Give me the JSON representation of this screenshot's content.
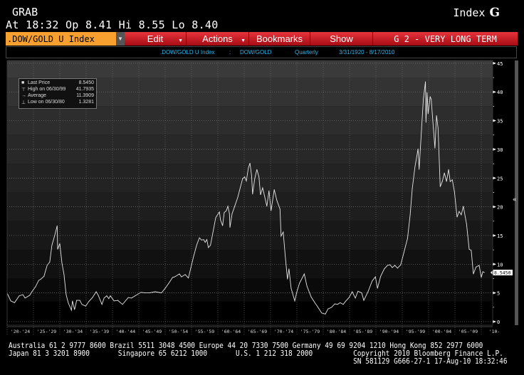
{
  "header": {
    "function": "GRAB",
    "security_type": "Index",
    "security_type_key": "G",
    "quote": "At 18:32   Op 8.41 Hi 8.55 Lo 8.40"
  },
  "toolbar": {
    "ticker": ".DOW/GOLD U Index",
    "edit": "Edit",
    "actions": "Actions",
    "bookmarks": "Bookmarks",
    "show": "Show",
    "title": "G 2 - VERY LONG TERM"
  },
  "subheader": {
    "ticker": ".DOW/GOLD U Index",
    "separator": ":",
    "name": "DOW/GOLD",
    "periodicity": "Quarterly",
    "range": "3/31/1920  -  8/17/2010"
  },
  "legend": {
    "rows": [
      {
        "label": "Last Price",
        "value": "8.5450",
        "icon": "square-icon"
      },
      {
        "label": "High on 06/30/99",
        "value": "41.7935",
        "icon": "high-marker-icon"
      },
      {
        "label": "Average",
        "value": "11.3909",
        "icon": "average-arrow-icon"
      },
      {
        "label": "Low on 06/30/80",
        "value": "1.3281",
        "icon": "low-marker-icon"
      }
    ]
  },
  "chart_data": {
    "type": "line",
    "ylim": [
      0,
      45
    ],
    "xlim": [
      1920,
      2012.3
    ],
    "yticks": [
      "0",
      "5",
      "10",
      "15",
      "20",
      "25",
      "30",
      "35",
      "40",
      "45"
    ],
    "xticks": [
      "'20-'24",
      "'25-'29",
      "'30-'34",
      "'35-'39",
      "'40-'44",
      "'45-'49",
      "'50-'54",
      "'55-'59",
      "'60-'64",
      "'65-'69",
      "'70-'74",
      "'75-'79",
      "'80-'84",
      "'85-'89",
      "'90-'94",
      "'95-'99",
      "'00-'04",
      "'05-'09",
      "'10-"
    ],
    "grid": true,
    "last_price_label": "8.5450",
    "colors": {
      "line": "#e6e6e6",
      "last_price_tag": "#ffffff"
    },
    "series": [
      {
        "points": [
          [
            1920.0,
            4.96
          ],
          [
            1920.7,
            3.6
          ],
          [
            1921.4,
            3.3
          ],
          [
            1922.3,
            4.5
          ],
          [
            1923.0,
            4.7
          ],
          [
            1923.4,
            4.1
          ],
          [
            1924.3,
            4.6
          ],
          [
            1924.7,
            5.2
          ],
          [
            1925.4,
            6.1
          ],
          [
            1926.0,
            7.2
          ],
          [
            1926.4,
            7.4
          ],
          [
            1927.0,
            7.9
          ],
          [
            1927.6,
            9.8
          ],
          [
            1928.1,
            10.4
          ],
          [
            1928.5,
            13.3
          ],
          [
            1929.0,
            14.9
          ],
          [
            1929.5,
            16.7
          ],
          [
            1929.6,
            12.6
          ],
          [
            1930.0,
            13.6
          ],
          [
            1930.4,
            10.2
          ],
          [
            1930.8,
            8.2
          ],
          [
            1931.2,
            4.7
          ],
          [
            1931.6,
            3.3
          ],
          [
            1932.2,
            2.0
          ],
          [
            1932.4,
            3.6
          ],
          [
            1932.8,
            2.1
          ],
          [
            1933.2,
            3.7
          ],
          [
            1933.8,
            3.7
          ],
          [
            1934.2,
            3.0
          ],
          [
            1934.9,
            2.7
          ],
          [
            1935.5,
            3.5
          ],
          [
            1936.2,
            4.2
          ],
          [
            1936.9,
            5.2
          ],
          [
            1937.3,
            4.6
          ],
          [
            1938.0,
            3.0
          ],
          [
            1938.4,
            4.1
          ],
          [
            1938.9,
            4.5
          ],
          [
            1939.3,
            4.0
          ],
          [
            1939.6,
            4.5
          ],
          [
            1940.3,
            3.6
          ],
          [
            1941.0,
            3.7
          ],
          [
            1941.9,
            3.0
          ],
          [
            1943.0,
            4.2
          ],
          [
            1943.6,
            4.1
          ],
          [
            1944.3,
            4.5
          ],
          [
            1945.4,
            5.1
          ],
          [
            1946.2,
            5.0
          ],
          [
            1947.0,
            5.0
          ],
          [
            1948.1,
            5.2
          ],
          [
            1949.3,
            5.0
          ],
          [
            1950.0,
            5.8
          ],
          [
            1950.7,
            6.7
          ],
          [
            1951.4,
            7.7
          ],
          [
            1951.8,
            7.8
          ],
          [
            1952.7,
            8.3
          ],
          [
            1953.1,
            7.8
          ],
          [
            1953.8,
            8.2
          ],
          [
            1954.4,
            7.6
          ],
          [
            1954.9,
            9.5
          ],
          [
            1955.4,
            11.4
          ],
          [
            1956.0,
            13.4
          ],
          [
            1956.5,
            14.6
          ],
          [
            1956.9,
            14.2
          ],
          [
            1957.3,
            14.3
          ],
          [
            1957.6,
            13.8
          ],
          [
            1957.9,
            14.3
          ],
          [
            1958.2,
            12.9
          ],
          [
            1958.6,
            13.3
          ],
          [
            1959.2,
            16.2
          ],
          [
            1959.6,
            18.1
          ],
          [
            1960.0,
            18.7
          ],
          [
            1960.3,
            19.1
          ],
          [
            1960.5,
            17.7
          ],
          [
            1960.9,
            16.7
          ],
          [
            1961.2,
            19.0
          ],
          [
            1961.6,
            19.3
          ],
          [
            1961.9,
            20.1
          ],
          [
            1962.2,
            18.8
          ],
          [
            1962.3,
            16.4
          ],
          [
            1962.7,
            18.8
          ],
          [
            1963.2,
            20.1
          ],
          [
            1963.8,
            21.7
          ],
          [
            1964.3,
            23.5
          ],
          [
            1964.7,
            24.9
          ],
          [
            1965.1,
            25.2
          ],
          [
            1965.4,
            24.5
          ],
          [
            1965.8,
            26.8
          ],
          [
            1966.1,
            27.6
          ],
          [
            1966.4,
            25.4
          ],
          [
            1966.6,
            22.2
          ],
          [
            1967.0,
            24.9
          ],
          [
            1967.4,
            26.5
          ],
          [
            1967.8,
            25.2
          ],
          [
            1968.1,
            22.1
          ],
          [
            1968.5,
            23.3
          ],
          [
            1968.9,
            21.7
          ],
          [
            1969.3,
            20.1
          ],
          [
            1969.7,
            22.8
          ],
          [
            1970.1,
            19.3
          ],
          [
            1970.7,
            23.0
          ],
          [
            1971.2,
            21.1
          ],
          [
            1971.8,
            19.6
          ],
          [
            1972.0,
            14.9
          ],
          [
            1972.4,
            15.6
          ],
          [
            1972.8,
            11.4
          ],
          [
            1973.2,
            7.4
          ],
          [
            1973.5,
            9.2
          ],
          [
            1973.9,
            5.8
          ],
          [
            1974.6,
            3.6
          ],
          [
            1975.0,
            5.2
          ],
          [
            1975.5,
            6.7
          ],
          [
            1976.4,
            8.3
          ],
          [
            1976.9,
            6.2
          ],
          [
            1977.7,
            4.3
          ],
          [
            1978.4,
            3.3
          ],
          [
            1979.0,
            2.5
          ],
          [
            1979.7,
            1.5
          ],
          [
            1980.4,
            1.33
          ],
          [
            1980.9,
            2.2
          ],
          [
            1981.6,
            2.5
          ],
          [
            1982.2,
            3.1
          ],
          [
            1982.7,
            3.0
          ],
          [
            1983.2,
            3.3
          ],
          [
            1983.8,
            3.0
          ],
          [
            1984.2,
            3.5
          ],
          [
            1984.9,
            4.2
          ],
          [
            1985.5,
            5.2
          ],
          [
            1986.1,
            4.1
          ],
          [
            1986.6,
            5.3
          ],
          [
            1987.3,
            5.0
          ],
          [
            1987.7,
            3.7
          ],
          [
            1988.5,
            5.2
          ],
          [
            1989.3,
            7.1
          ],
          [
            1989.9,
            7.8
          ],
          [
            1990.3,
            5.8
          ],
          [
            1990.9,
            7.9
          ],
          [
            1991.6,
            9.2
          ],
          [
            1992.2,
            9.8
          ],
          [
            1992.7,
            9.9
          ],
          [
            1993.1,
            9.4
          ],
          [
            1993.6,
            9.8
          ],
          [
            1994.1,
            9.3
          ],
          [
            1994.7,
            9.9
          ],
          [
            1995.3,
            12.0
          ],
          [
            1996.0,
            14.5
          ],
          [
            1996.5,
            18.6
          ],
          [
            1996.9,
            23.2
          ],
          [
            1997.4,
            26.9
          ],
          [
            1998.0,
            30.1
          ],
          [
            1998.2,
            26.5
          ],
          [
            1998.6,
            32.5
          ],
          [
            1999.0,
            38.7
          ],
          [
            1999.4,
            41.79
          ],
          [
            1999.5,
            34.7
          ],
          [
            1999.7,
            39.9
          ],
          [
            1999.9,
            36.2
          ],
          [
            2000.3,
            39.2
          ],
          [
            2000.5,
            38.7
          ],
          [
            2000.9,
            33.7
          ],
          [
            2001.2,
            30.2
          ],
          [
            2001.5,
            35.9
          ],
          [
            2001.8,
            33.7
          ],
          [
            2002.2,
            23.5
          ],
          [
            2002.6,
            24.4
          ],
          [
            2003.0,
            25.9
          ],
          [
            2003.4,
            24.4
          ],
          [
            2003.8,
            26.5
          ],
          [
            2004.1,
            24.4
          ],
          [
            2004.5,
            24.7
          ],
          [
            2004.9,
            22.6
          ],
          [
            2005.4,
            18.2
          ],
          [
            2005.8,
            19.2
          ],
          [
            2006.2,
            18.6
          ],
          [
            2006.6,
            20.1
          ],
          [
            2007.2,
            17.0
          ],
          [
            2007.7,
            12.6
          ],
          [
            2008.1,
            12.4
          ],
          [
            2008.5,
            8.3
          ],
          [
            2009.0,
            9.5
          ],
          [
            2009.6,
            9.8
          ],
          [
            2010.0,
            7.7
          ],
          [
            2010.3,
            8.7
          ],
          [
            2010.6,
            8.545
          ]
        ]
      }
    ]
  },
  "footer": {
    "line1": "Australia 61 2 9777 8600 Brazil 5511 3048 4500 Europe 44 20 7330 7500 Germany 49 69 9204 1210 Hong Kong 852 2977 6000",
    "line2": "Japan 81 3 3201 8900       Singapore 65 6212 1000       U.S. 1 212 318 2000          Copyright 2010 Bloomberg Finance L.P.",
    "line3": "                                                                                     SN 581129 G666-27-1 17-Aug-10 18:32:46"
  }
}
